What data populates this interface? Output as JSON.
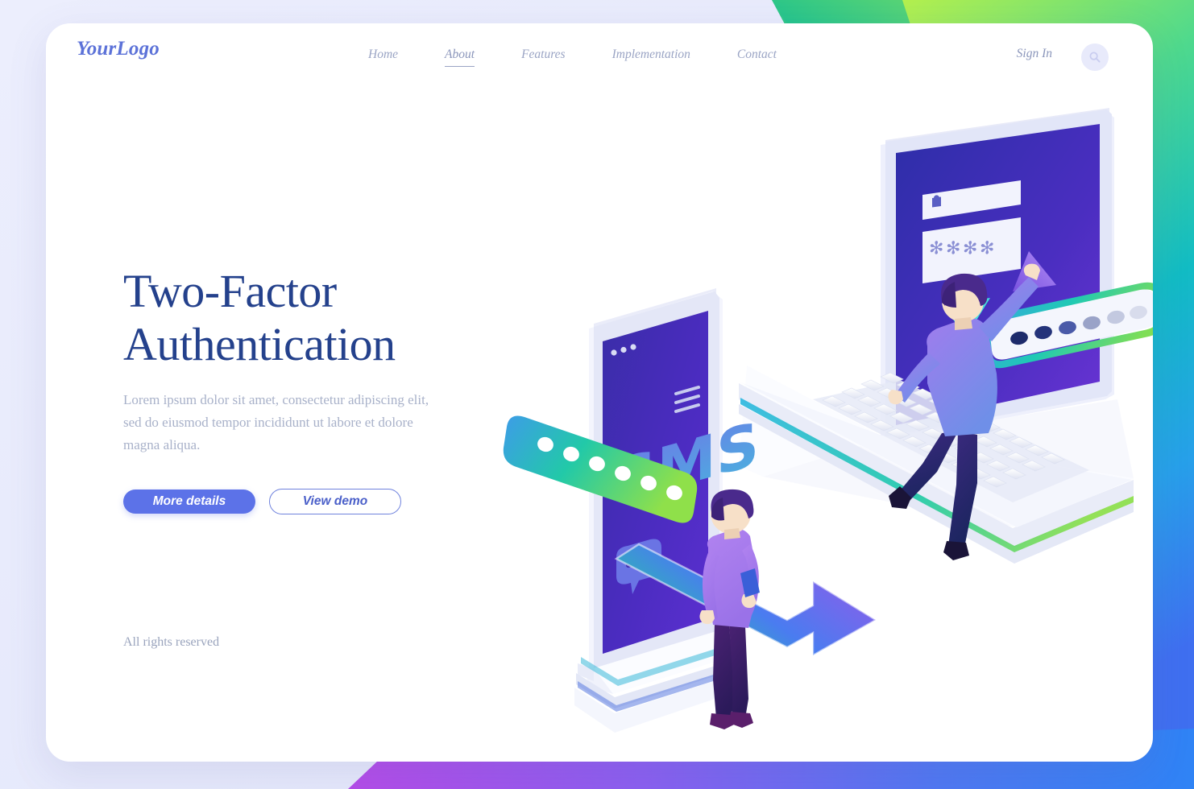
{
  "brand": {
    "logo": "YourLogo"
  },
  "nav": {
    "items": [
      {
        "label": "Home",
        "active": false
      },
      {
        "label": "About",
        "active": true
      },
      {
        "label": "Features",
        "active": false
      },
      {
        "label": "Implementation",
        "active": false
      },
      {
        "label": "Contact",
        "active": false
      }
    ],
    "signin_label": "Sign In",
    "search_icon": "search-icon"
  },
  "hero": {
    "title_line1": "Two-Factor",
    "title_line2": "Authentication",
    "paragraph": "Lorem ipsum dolor sit amet, consectetur adipiscing elit, sed do eiusmod tempor incididunt ut labore et dolore magna aliqua.",
    "primary_button": "More details",
    "secondary_button": "View demo"
  },
  "footer": {
    "rights": "All rights reserved"
  },
  "illustration": {
    "phone_label": "SMS",
    "phone_icons": [
      "hamburger-menu-icon",
      "chat-bubble-icon",
      "three-dots-icon"
    ],
    "laptop_fields": {
      "username_icon": "user-icon",
      "password_value": "****"
    },
    "laptop_icons": [
      "triangle-down-icon",
      "triangle-up-icon"
    ],
    "password_bar_dots": 6,
    "characters": 2
  },
  "colors": {
    "brand_blue": "#5c72d8",
    "heading_navy": "#24418c",
    "body_text": "#a8b1c9",
    "primary_button_bg": "#5c72e8",
    "card_bg": "#ffffff",
    "page_bg": "#e6e8fb",
    "accent_green": "#a6e84f",
    "accent_teal": "#19c2c2",
    "accent_blue": "#3d7ef0",
    "accent_purple": "#a04ce0"
  }
}
